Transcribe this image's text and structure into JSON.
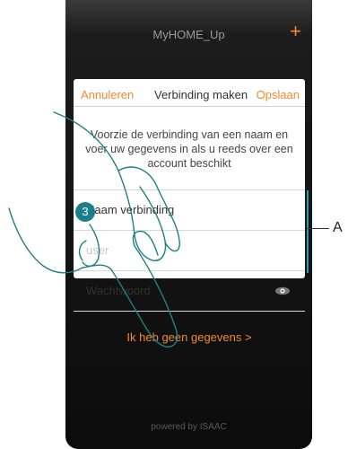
{
  "app": {
    "title": "MyHOME_Up",
    "add_glyph": "+",
    "footer": "powered by ISAAC"
  },
  "dialog": {
    "cancel_label": "Annuleren",
    "title": "Verbinding maken",
    "save_label": "Opslaan",
    "intro": "Voorzie de verbinding van een naam en voer uw gegevens in als u reeds over een account beschikt",
    "fields": {
      "name_placeholder": "Naam verbinding",
      "user_placeholder": "user",
      "password_placeholder": "Wachtwoord"
    },
    "link_label": "Ik heb geen gegevens >"
  },
  "annotation": {
    "step": "3",
    "letter": "A"
  },
  "colors": {
    "accent": "#f08a2a",
    "teal": "#1b7f8a",
    "callout": "#2e9aa8"
  },
  "icons": {
    "add": "plus-icon",
    "password_toggle": "eye-icon"
  }
}
